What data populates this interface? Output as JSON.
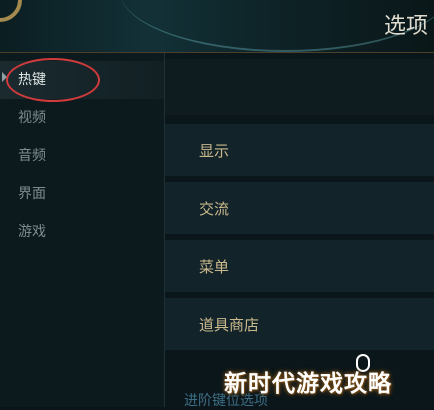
{
  "header": {
    "title": "选项"
  },
  "sidebar": {
    "items": [
      {
        "label": "热键",
        "active": true
      },
      {
        "label": "视频",
        "active": false
      },
      {
        "label": "音频",
        "active": false
      },
      {
        "label": "界面",
        "active": false
      },
      {
        "label": "游戏",
        "active": false
      }
    ]
  },
  "content": {
    "rows": [
      {
        "label": "显示"
      },
      {
        "label": "交流"
      },
      {
        "label": "菜单"
      },
      {
        "label": "道具商店"
      }
    ],
    "sub_link": "进阶键位选项"
  },
  "watermark": {
    "text": "新时代游戏攻略"
  },
  "colors": {
    "background": "#0a1419",
    "row_label": "#c9b98c",
    "sidebar_text": "#7d8c8d",
    "annotation": "#d23b3b",
    "accent_gold": "#a58a4f"
  }
}
